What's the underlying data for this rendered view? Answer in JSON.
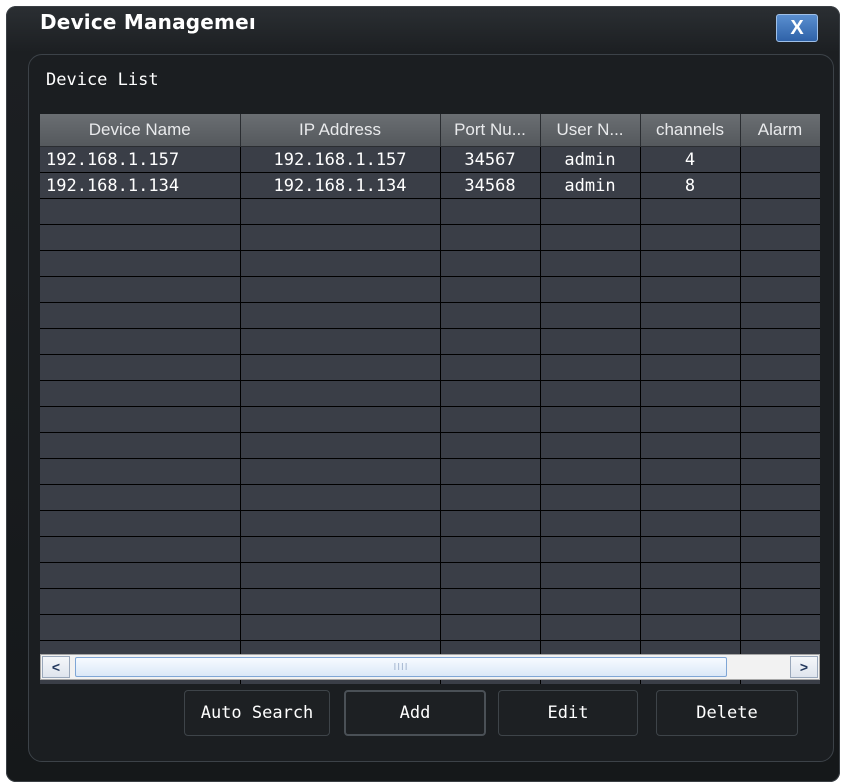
{
  "window": {
    "title": "Device Managemeı"
  },
  "close_button": {
    "label": "X"
  },
  "section": {
    "label": "Device List"
  },
  "table": {
    "columns": [
      "Device Name",
      "IP Address",
      "Port Nu...",
      "User N...",
      "channels",
      "Alarm"
    ],
    "rows": [
      [
        "192.168.1.157",
        "192.168.1.157",
        "34567",
        "admin",
        "4",
        ""
      ],
      [
        "192.168.1.134",
        "192.168.1.134",
        "34568",
        "admin",
        "8",
        ""
      ]
    ]
  },
  "scrollbar": {
    "left_arrow": "<",
    "right_arrow": ">",
    "grip": "IIII"
  },
  "buttons": {
    "auto_search": "Auto Search",
    "add": "Add",
    "edit": "Edit",
    "delete": "Delete"
  }
}
